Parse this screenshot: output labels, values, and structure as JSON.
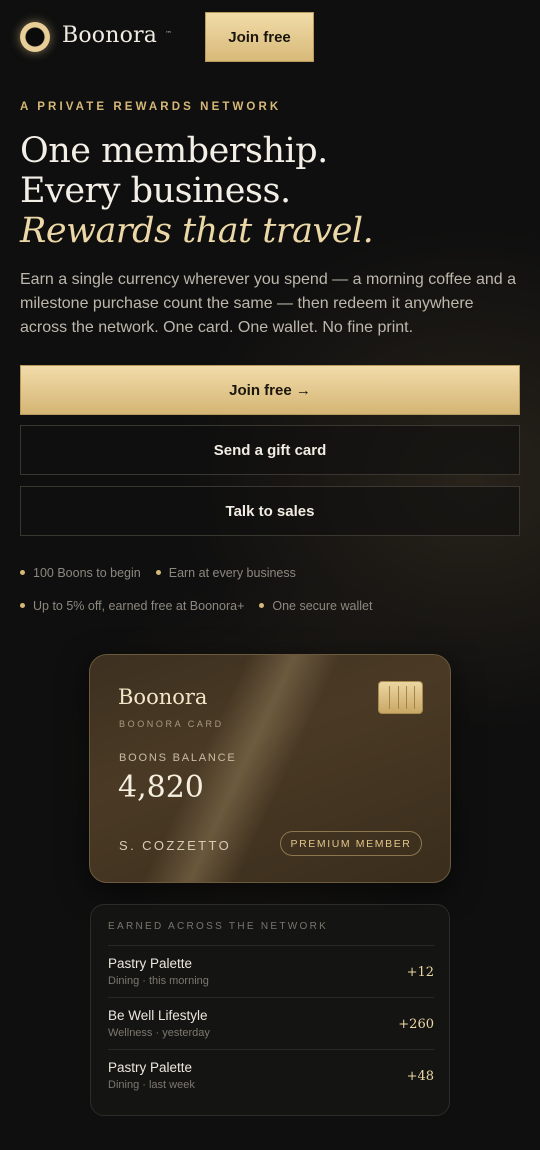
{
  "header": {
    "brand": "Boonora",
    "trademark": "™",
    "join_label": "Join free"
  },
  "hero": {
    "eyebrow": "A PRIVATE REWARDS NETWORK",
    "headline_line1": "One membership.",
    "headline_line2": "Every business.",
    "headline_line3": "Rewards that travel.",
    "lead": "Earn a single currency wherever you spend — a morning coffee and a milestone purchase count the same — then redeem it anywhere across the network. One card. One wallet. No fine print."
  },
  "cta": {
    "primary": "Join free →",
    "gift": "Send a gift card",
    "sales": "Talk to sales"
  },
  "perks": [
    "100 Boons to begin",
    "Earn at every business",
    "Up to 5% off, earned free at Boonora+",
    "One secure wallet"
  ],
  "card": {
    "brand": "Boonora",
    "subtitle": "BOONORA CARD",
    "balance_label": "BOONS BALANCE",
    "balance": "4,820",
    "holder": "S. COZZETTO",
    "tier": "PREMIUM MEMBER"
  },
  "activity": {
    "title": "EARNED ACROSS THE NETWORK",
    "items": [
      {
        "name": "Pastry Palette",
        "meta": "Dining · this morning",
        "points": "+12"
      },
      {
        "name": "Be Well Lifestyle",
        "meta": "Wellness · yesterday",
        "points": "+260"
      },
      {
        "name": "Pastry Palette",
        "meta": "Dining · last week",
        "points": "+48"
      }
    ]
  },
  "colors": {
    "background": "#0f0f0f",
    "gold": "#d6b877",
    "gold_light": "#f1dca9",
    "text": "#f3efe7"
  }
}
